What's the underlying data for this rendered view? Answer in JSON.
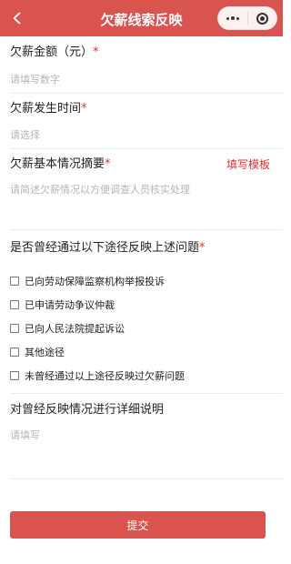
{
  "header": {
    "title": "欠薪线索反映",
    "colors": {
      "bar": "#d9534f",
      "text": "#ffffff"
    }
  },
  "form": {
    "amount": {
      "label": "欠薪金额（元）",
      "placeholder": "请填写数字"
    },
    "time": {
      "label": "欠薪发生时间",
      "placeholder": "请选择"
    },
    "summary": {
      "label": "欠薪基本情况摘要",
      "link": "填写模板",
      "placeholder": "请简述欠薪情况以方便调查人员核实处理"
    },
    "channels": {
      "label": "是否曾经通过以下途径反映上述问题",
      "options": [
        {
          "label": "已向劳动保障监察机构举报投诉",
          "checked": false
        },
        {
          "label": "已申请劳动争议仲裁",
          "checked": false
        },
        {
          "label": "已向人民法院提起诉讼",
          "checked": false
        },
        {
          "label": "其他途径",
          "checked": false
        },
        {
          "label": "未曾经通过以上途径反映过欠薪问题",
          "checked": false
        }
      ]
    },
    "details": {
      "label": "对曾经反映情况进行详细说明",
      "placeholder": "请填写"
    },
    "required_mark": "*",
    "submit_label": "提交"
  },
  "colors": {
    "accent": "#d9534f",
    "required": "#e0302c",
    "placeholder": "#b5b5b5"
  }
}
